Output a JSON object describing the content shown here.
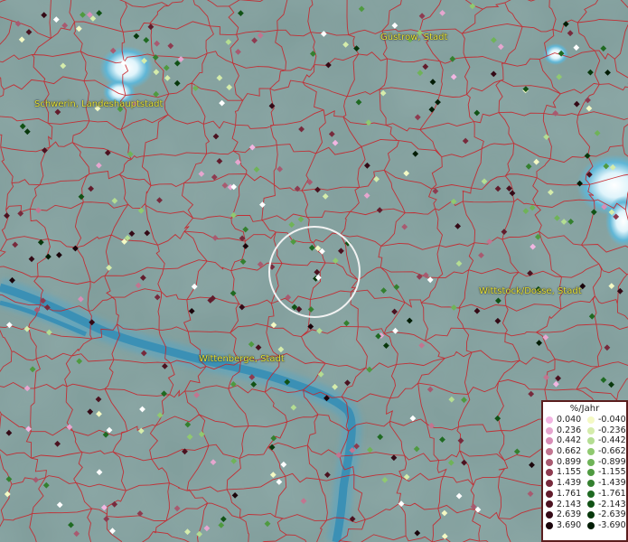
{
  "map": {
    "labels": [
      {
        "text": "Schwerin, Landeshauptstadt"
      },
      {
        "text": "Güstrow, Stadt"
      },
      {
        "text": "Wittstock/Dosse, Stadt"
      },
      {
        "text": "Wittenberge, Stadt"
      }
    ],
    "colors": {
      "background": "#7f9c9a",
      "border_lines": "#c8242a",
      "river": "#2f8bb5",
      "label": "#e8e53a",
      "selection_circle": "#f2f2f2"
    }
  },
  "legend": {
    "title": "%/Jahr",
    "positive": [
      {
        "value": "0.040",
        "color": "#f2b6e2"
      },
      {
        "value": "0.236",
        "color": "#e6a6cf"
      },
      {
        "value": "0.442",
        "color": "#d88db6"
      },
      {
        "value": "0.662",
        "color": "#c27590"
      },
      {
        "value": "0.899",
        "color": "#a85a70"
      },
      {
        "value": "1.155",
        "color": "#8e3b50"
      },
      {
        "value": "1.439",
        "color": "#772a3c"
      },
      {
        "value": "1.761",
        "color": "#621c2c"
      },
      {
        "value": "2.143",
        "color": "#4b1220"
      },
      {
        "value": "2.639",
        "color": "#340a16"
      },
      {
        "value": "3.690",
        "color": "#1a050b"
      }
    ],
    "negative": [
      {
        "value": "-0.040",
        "color": "#f4f9c4"
      },
      {
        "value": "-0.236",
        "color": "#d5ecab"
      },
      {
        "value": "-0.442",
        "color": "#b4dd92"
      },
      {
        "value": "-0.662",
        "color": "#90c970"
      },
      {
        "value": "-0.899",
        "color": "#6fb358"
      },
      {
        "value": "-1.155",
        "color": "#4f9a40"
      },
      {
        "value": "-1.439",
        "color": "#34802f"
      },
      {
        "value": "-1.761",
        "color": "#1f6a22"
      },
      {
        "value": "-2.143",
        "color": "#115215"
      },
      {
        "value": "-2.639",
        "color": "#08380c"
      },
      {
        "value": "-3.690",
        "color": "#021c05"
      }
    ]
  }
}
